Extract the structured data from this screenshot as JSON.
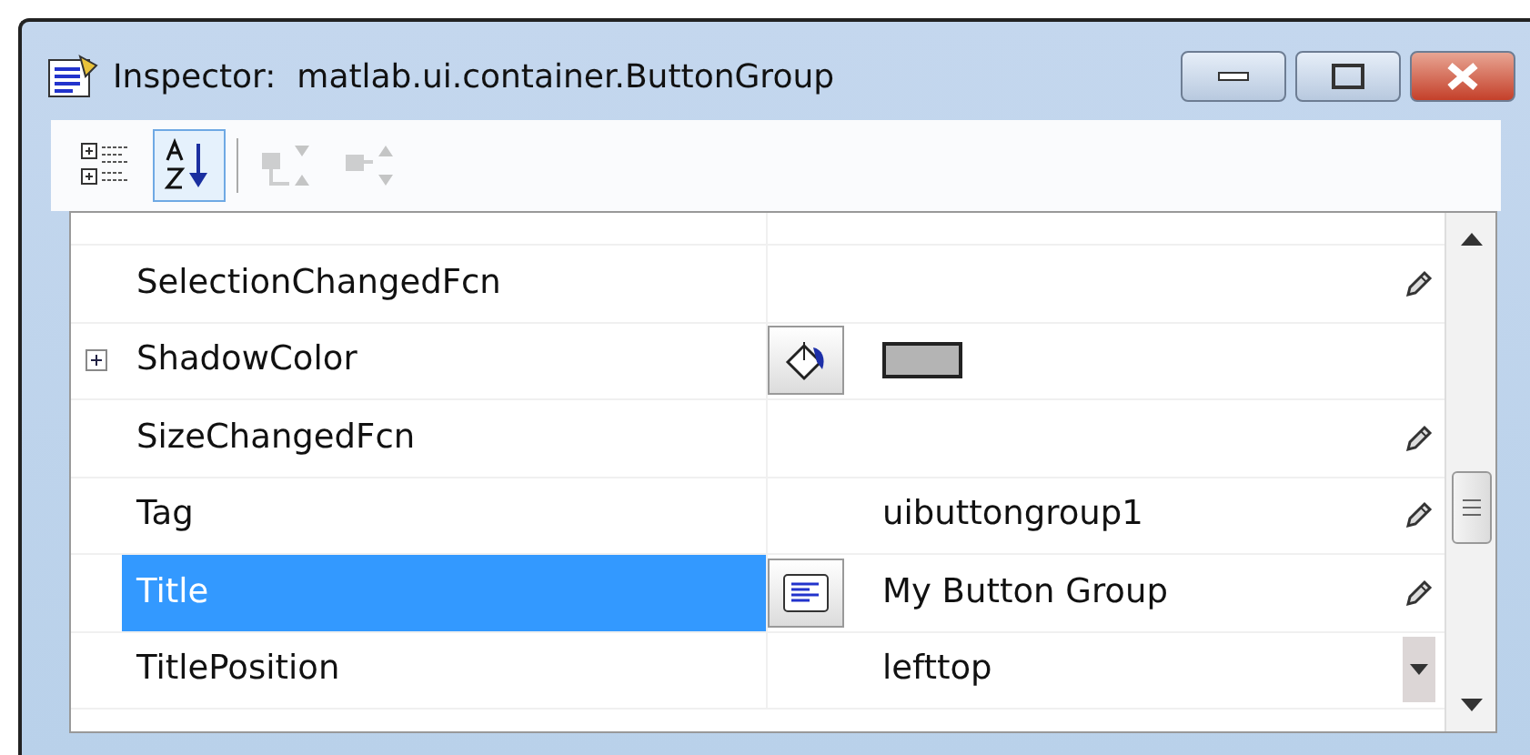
{
  "window": {
    "title": "Inspector:  matlab.ui.container.ButtonGroup"
  },
  "toolbar": [
    {
      "kind": "categorized",
      "selected": false,
      "disabled": false
    },
    {
      "kind": "alphabetical",
      "selected": true,
      "disabled": false
    },
    {
      "kind": "separator"
    },
    {
      "kind": "expand",
      "selected": false,
      "disabled": true
    },
    {
      "kind": "collapse",
      "selected": false,
      "disabled": true
    }
  ],
  "properties": [
    {
      "name": "SelectionChangedFcn",
      "expandable": false,
      "selected": false,
      "action": {
        "kind": "edit"
      }
    },
    {
      "name": "ShadowColor",
      "expandable": true,
      "selected": false,
      "editor": {
        "kind": "color"
      },
      "swatch": {
        "color": "#b4b4b4"
      }
    },
    {
      "name": "SizeChangedFcn",
      "expandable": false,
      "selected": false,
      "action": {
        "kind": "edit"
      }
    },
    {
      "name": "Tag",
      "expandable": false,
      "selected": false,
      "value": "uibuttongroup1",
      "action": {
        "kind": "edit"
      }
    },
    {
      "name": "Title",
      "expandable": false,
      "selected": true,
      "editor": {
        "kind": "text"
      },
      "value": "My Button Group",
      "action": {
        "kind": "edit"
      }
    },
    {
      "name": "TitlePosition",
      "expandable": false,
      "selected": false,
      "value": "lefttop",
      "action": {
        "kind": "dropdown"
      }
    }
  ]
}
